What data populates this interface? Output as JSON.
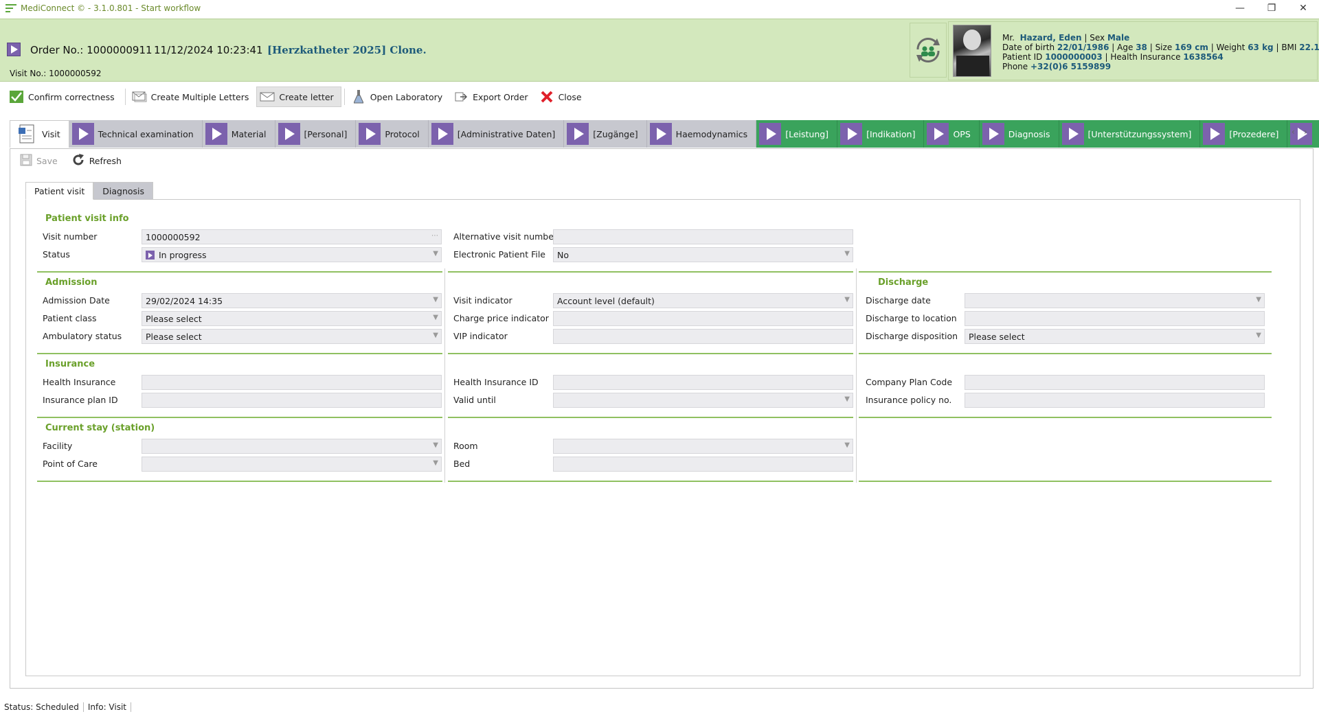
{
  "window": {
    "title": "MediConnect © - 3.1.0.801 - Start workflow",
    "controls": [
      "minimize-icon",
      "restore-icon",
      "close-icon"
    ]
  },
  "header": {
    "order_no": "Order No.: 1000000911",
    "order_date": "11/12/2024 10:23:41",
    "workflow_name": "[Herzkatheter 2025] Clone.",
    "visit_no": "Visit No.: 1000000592",
    "patient": {
      "salutation": "Mr.",
      "name": "Hazard, Eden",
      "sex_label": "Sex",
      "sex": "Male",
      "dob_label": "Date of birth",
      "dob": "22/01/1986",
      "age_label": "Age",
      "age": "38",
      "size_label": "Size",
      "size": "169 cm",
      "weight_label": "Weight",
      "weight": "63 kg",
      "bmi_label": "BMI",
      "bmi": "22.1",
      "pid_label": "Patient ID",
      "pid": "1000000003",
      "insurance_label": "Health Insurance",
      "insurance": "1638564",
      "phone_label": "Phone",
      "phone": "+32(0)6 5159899"
    }
  },
  "toolbar": {
    "confirm": "Confirm correctness",
    "multiple_letters": "Create Multiple Letters",
    "create_letter": "Create letter",
    "open_lab": "Open Laboratory",
    "export": "Export Order",
    "close": "Close"
  },
  "workflow_tabs": [
    {
      "label": "Visit"
    },
    {
      "label": "Technical examination"
    },
    {
      "label": "Material"
    },
    {
      "label": "[Personal]"
    },
    {
      "label": "Protocol"
    },
    {
      "label": "[Administrative Daten]"
    },
    {
      "label": "[Zugänge]"
    },
    {
      "label": "Haemodynamics"
    },
    {
      "label": "[Leistung]"
    },
    {
      "label": "[Indikation]"
    },
    {
      "label": "OPS"
    },
    {
      "label": "Diagnosis"
    },
    {
      "label": "[Unterstützungssystem]"
    },
    {
      "label": "[Prozedere]"
    }
  ],
  "panel_toolbar": {
    "save": "Save",
    "refresh": "Refresh"
  },
  "subtabs": [
    "Patient visit",
    "Diagnosis"
  ],
  "sections": {
    "patient_visit_info": "Patient visit info",
    "admission": "Admission",
    "discharge": "Discharge",
    "insurance": "Insurance",
    "current_stay": "Current stay (station)"
  },
  "fields": {
    "visit_number": {
      "label": "Visit number",
      "value": "1000000592"
    },
    "status": {
      "label": "Status",
      "value": "In progress"
    },
    "alt_visit_number": {
      "label": "Alternative visit number",
      "value": ""
    },
    "electronic_patient_file": {
      "label": "Electronic Patient File",
      "value": "No"
    },
    "admission_date": {
      "label": "Admission Date",
      "value": "29/02/2024 14:35"
    },
    "patient_class": {
      "label": "Patient class",
      "value": "Please select"
    },
    "ambulatory_status": {
      "label": "Ambulatory status",
      "value": "Please select"
    },
    "visit_indicator": {
      "label": "Visit indicator",
      "value": "Account level (default)"
    },
    "charge_price_indicator": {
      "label": "Charge price indicator",
      "value": ""
    },
    "vip_indicator": {
      "label": "VIP indicator",
      "value": ""
    },
    "discharge_date": {
      "label": "Discharge date",
      "value": ""
    },
    "discharge_location": {
      "label": "Discharge to location",
      "value": ""
    },
    "discharge_disposition": {
      "label": "Discharge disposition",
      "value": "Please select"
    },
    "health_insurance": {
      "label": "Health Insurance",
      "value": ""
    },
    "insurance_plan_id": {
      "label": "Insurance plan ID",
      "value": ""
    },
    "health_insurance_id": {
      "label": "Health Insurance ID",
      "value": ""
    },
    "valid_until": {
      "label": "Valid until",
      "value": ""
    },
    "company_plan_code": {
      "label": "Company Plan Code",
      "value": ""
    },
    "insurance_policy_no": {
      "label": "Insurance policy no.",
      "value": ""
    },
    "facility": {
      "label": "Facility",
      "value": ""
    },
    "point_of_care": {
      "label": "Point of Care",
      "value": ""
    },
    "room": {
      "label": "Room",
      "value": ""
    },
    "bed": {
      "label": "Bed",
      "value": ""
    }
  },
  "statusbar": {
    "status": "Status: Scheduled",
    "info": "Info: Visit"
  }
}
